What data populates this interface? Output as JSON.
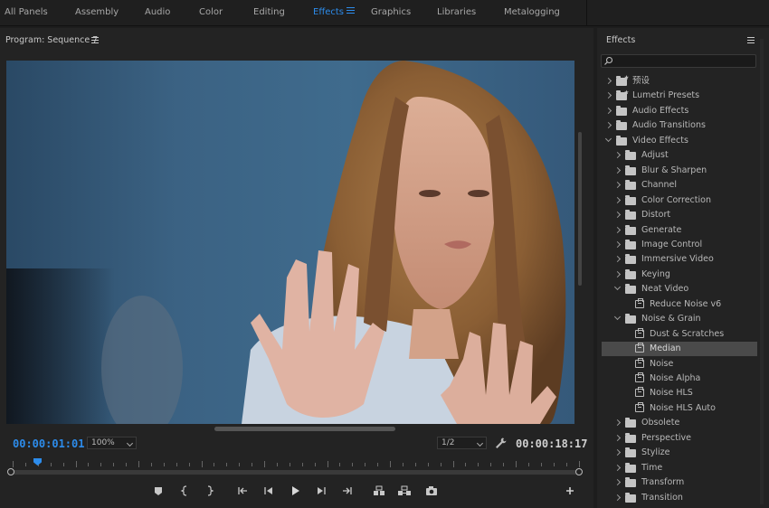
{
  "workspace_tabs": [
    "All Panels",
    "Assembly",
    "Audio",
    "Color",
    "Editing",
    "Effects",
    "Graphics",
    "Libraries",
    "Metalogging"
  ],
  "active_tab": "Effects",
  "program": {
    "title": "Program: Sequence 7",
    "current_time": "00:00:01:01",
    "duration": "00:00:18:17",
    "zoom": "100%",
    "resolution": "1/2"
  },
  "effects": {
    "title": "Effects",
    "search_value": "",
    "tree": [
      {
        "label": "预设",
        "depth": 0,
        "icon": "star-folder",
        "expanded": false
      },
      {
        "label": "Lumetri Presets",
        "depth": 0,
        "icon": "star-folder",
        "expanded": false
      },
      {
        "label": "Audio Effects",
        "depth": 0,
        "icon": "folder",
        "expanded": false
      },
      {
        "label": "Audio Transitions",
        "depth": 0,
        "icon": "folder",
        "expanded": false
      },
      {
        "label": "Video Effects",
        "depth": 0,
        "icon": "folder",
        "expanded": true
      },
      {
        "label": "Adjust",
        "depth": 1,
        "icon": "folder",
        "expanded": false
      },
      {
        "label": "Blur & Sharpen",
        "depth": 1,
        "icon": "folder",
        "expanded": false
      },
      {
        "label": "Channel",
        "depth": 1,
        "icon": "folder",
        "expanded": false
      },
      {
        "label": "Color Correction",
        "depth": 1,
        "icon": "folder",
        "expanded": false
      },
      {
        "label": "Distort",
        "depth": 1,
        "icon": "folder",
        "expanded": false
      },
      {
        "label": "Generate",
        "depth": 1,
        "icon": "folder",
        "expanded": false
      },
      {
        "label": "Image Control",
        "depth": 1,
        "icon": "folder",
        "expanded": false
      },
      {
        "label": "Immersive Video",
        "depth": 1,
        "icon": "folder",
        "expanded": false
      },
      {
        "label": "Keying",
        "depth": 1,
        "icon": "folder",
        "expanded": false
      },
      {
        "label": "Neat Video",
        "depth": 1,
        "icon": "folder",
        "expanded": true
      },
      {
        "label": "Reduce Noise v6",
        "depth": 2,
        "icon": "effect"
      },
      {
        "label": "Noise & Grain",
        "depth": 1,
        "icon": "folder",
        "expanded": true
      },
      {
        "label": "Dust & Scratches",
        "depth": 2,
        "icon": "effect"
      },
      {
        "label": "Median",
        "depth": 2,
        "icon": "effect",
        "selected": true
      },
      {
        "label": "Noise",
        "depth": 2,
        "icon": "effect"
      },
      {
        "label": "Noise Alpha",
        "depth": 2,
        "icon": "effect"
      },
      {
        "label": "Noise HLS",
        "depth": 2,
        "icon": "effect"
      },
      {
        "label": "Noise HLS Auto",
        "depth": 2,
        "icon": "effect"
      },
      {
        "label": "Obsolete",
        "depth": 1,
        "icon": "folder",
        "expanded": false
      },
      {
        "label": "Perspective",
        "depth": 1,
        "icon": "folder",
        "expanded": false
      },
      {
        "label": "Stylize",
        "depth": 1,
        "icon": "folder",
        "expanded": false
      },
      {
        "label": "Time",
        "depth": 1,
        "icon": "folder",
        "expanded": false
      },
      {
        "label": "Transform",
        "depth": 1,
        "icon": "folder",
        "expanded": false
      },
      {
        "label": "Transition",
        "depth": 1,
        "icon": "folder",
        "expanded": false
      }
    ]
  },
  "colors": {
    "accent": "#2d8ceb",
    "selected_row": "#4a4a4a",
    "panel_bg": "#232323"
  },
  "controls": [
    "add-marker-icon",
    "mark-in-icon",
    "mark-out-icon",
    "go-to-in-icon",
    "step-back-icon",
    "play-icon",
    "step-forward-icon",
    "go-to-out-icon",
    "lift-icon",
    "extract-icon",
    "export-frame-icon",
    "add-button-icon"
  ]
}
